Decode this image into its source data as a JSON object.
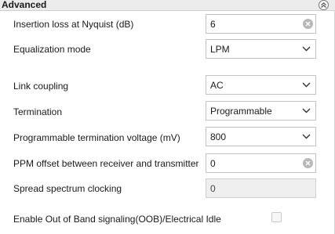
{
  "section": {
    "title": "Advanced",
    "collapse_icon": "chevron-up-circle-icon"
  },
  "rows": {
    "insertion_loss": {
      "label": "Insertion loss at Nyquist (dB)",
      "value": "6"
    },
    "equalization_mode": {
      "label": "Equalization mode",
      "value": "LPM"
    },
    "link_coupling": {
      "label": "Link coupling",
      "value": "AC"
    },
    "termination": {
      "label": "Termination",
      "value": "Programmable"
    },
    "termination_voltage": {
      "label": "Programmable termination voltage (mV)",
      "value": "800"
    },
    "ppm_offset": {
      "label": "PPM offset between receiver and transmitter",
      "value": "0"
    },
    "spread_spectrum": {
      "label": "Spread spectrum clocking",
      "value": "0"
    },
    "oob_signaling": {
      "label": "Enable Out of Band signaling(OOB)/Electrical Idle",
      "checked": false
    }
  },
  "icons": {
    "clear": "clear-icon",
    "dropdown": "chevron-down-icon"
  }
}
